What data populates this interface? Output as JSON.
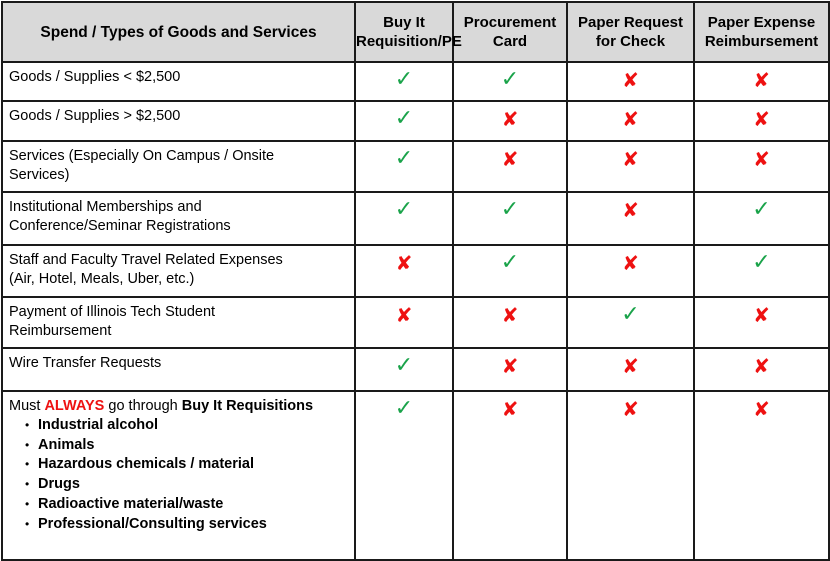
{
  "table": {
    "headers": [
      "Spend / Types of Goods and Services",
      [
        "Buy It",
        "Requisition/PE"
      ],
      [
        "Procurement",
        "Card"
      ],
      [
        "Paper Request",
        "for Check"
      ],
      [
        "Paper Expense",
        "Reimbursement"
      ]
    ],
    "header_labels": {
      "col0": "Spend / Types of Goods and Services",
      "col1_line1": "Buy It",
      "col1_line2": "Requisition/PE",
      "col2_line1": "Procurement",
      "col2_line2": "Card",
      "col3_line1": "Paper Request",
      "col3_line2": "for Check",
      "col4_line1": "Paper Expense",
      "col4_line2": "Reimbursement"
    },
    "icons": {
      "yes": "✓",
      "no": "✘",
      "yes_name": "checkmark-icon",
      "no_name": "cross-icon",
      "yes_color": "#1aa34a",
      "no_color": "#ee1111"
    },
    "rows": [
      {
        "label_line1": "Goods / Supplies < $2,500",
        "label_line2": "",
        "values": [
          "yes",
          "yes",
          "no",
          "no"
        ]
      },
      {
        "label_line1": "Goods / Supplies > $2,500",
        "label_line2": "",
        "values": [
          "yes",
          "no",
          "no",
          "no"
        ]
      },
      {
        "label_line1": "Services (Especially On Campus / Onsite",
        "label_line2": "Services)",
        "values": [
          "yes",
          "no",
          "no",
          "no"
        ]
      },
      {
        "label_line1": "Institutional Memberships and",
        "label_line2": "Conference/Seminar Registrations",
        "values": [
          "yes",
          "yes",
          "no",
          "yes"
        ]
      },
      {
        "label_line1": "Staff and Faculty Travel Related Expenses",
        "label_line2": "(Air, Hotel, Meals, Uber, etc.)",
        "values": [
          "no",
          "yes",
          "no",
          "yes"
        ]
      },
      {
        "label_line1": "Payment of Illinois Tech Student",
        "label_line2": "Reimbursement",
        "values": [
          "no",
          "no",
          "yes",
          "no"
        ]
      },
      {
        "label_line1": "Wire Transfer Requests",
        "label_line2": "",
        "values": [
          "yes",
          "no",
          "no",
          "no"
        ]
      }
    ],
    "last_row": {
      "prefix": "Must ",
      "emphasis": "ALWAYS",
      "middle": " go through ",
      "bold_tail": "Buy It Requisitions",
      "emphasis_color": "#ee1111",
      "bullet": "•",
      "items": [
        "Industrial alcohol",
        "Animals",
        "Hazardous chemicals / material",
        "Drugs",
        "Radioactive material/waste",
        "Professional/Consulting services"
      ],
      "values": [
        "yes",
        "no",
        "no",
        "no"
      ]
    }
  }
}
